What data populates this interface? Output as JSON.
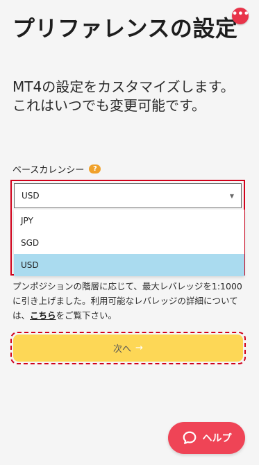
{
  "header": {
    "title": "プリファレンスの設定",
    "subtitle": "MT4の設定をカスタマイズします。これはいつでも変更可能です。",
    "more_icon": "more-dots-icon",
    "more_label": "•••"
  },
  "currency": {
    "label": "ベースカレンシー",
    "help_label": "?",
    "selected_value": "USD",
    "options": [
      "JPY",
      "SGD",
      "USD"
    ],
    "highlighted_option": "USD"
  },
  "info": {
    "text_before_link": "プンポジションの階層に応じて、最大レバレッジを1:1000に引き上げました。利用可能なレバレッジの詳細については、",
    "link_text": "こちら",
    "text_after_link": "をご覧下さい。"
  },
  "next_button": {
    "label": "次へ",
    "arrow": "→"
  },
  "help_button": {
    "label": "ヘルプ",
    "icon": "chat-bubble-icon"
  },
  "colors": {
    "accent_red": "#e8344a",
    "button_yellow": "#fdd756",
    "selected_option": "#aadbef",
    "annotation_red": "#d1011b",
    "help_badge": "#f0a12a"
  }
}
